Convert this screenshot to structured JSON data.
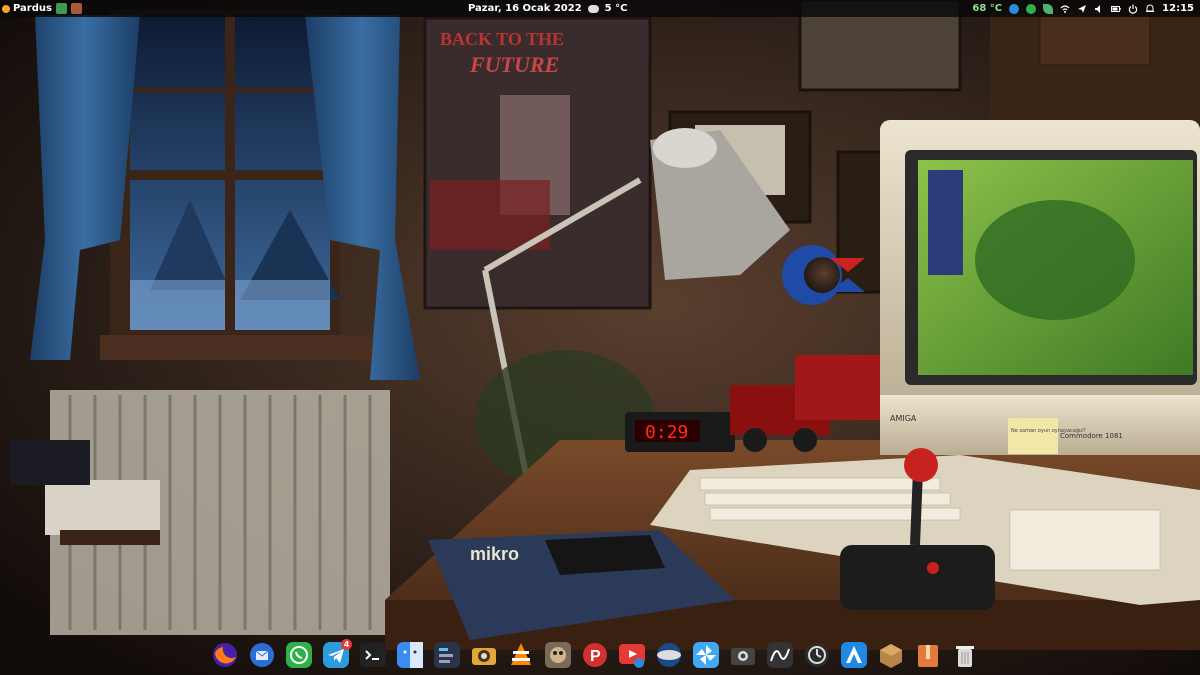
{
  "topbar": {
    "distro_label": "Pardus",
    "date": "Pazar, 16 Ocak 2022",
    "weather_temp": "5 °C",
    "cpu_temp": "68 °C",
    "time": "12:15"
  },
  "wallpaper": {
    "clock_display": "0:29",
    "monitor_brand": "AMIGA",
    "monitor_badge": "Commodore 1081",
    "magazine_title": "mikro",
    "sticky_note": "Ne zaman oyun oynayacağız?"
  },
  "dock": {
    "items": [
      {
        "name": "firefox-icon",
        "badge": ""
      },
      {
        "name": "thunderbird-icon",
        "badge": ""
      },
      {
        "name": "whatsapp-icon",
        "badge": ""
      },
      {
        "name": "telegram-icon",
        "badge": "4"
      },
      {
        "name": "terminal-icon",
        "badge": ""
      },
      {
        "name": "finder-icon",
        "badge": ""
      },
      {
        "name": "settings-panel-icon",
        "badge": ""
      },
      {
        "name": "camera-icon",
        "badge": ""
      },
      {
        "name": "vlc-icon",
        "badge": ""
      },
      {
        "name": "gimp-icon",
        "badge": ""
      },
      {
        "name": "pardus-p-icon",
        "badge": ""
      },
      {
        "name": "downloader-icon",
        "badge": ""
      },
      {
        "name": "vpn-icon",
        "badge": ""
      },
      {
        "name": "pinwheel-icon",
        "badge": ""
      },
      {
        "name": "screenshot-icon",
        "badge": ""
      },
      {
        "name": "curve-icon",
        "badge": ""
      },
      {
        "name": "timeshift-icon",
        "badge": ""
      },
      {
        "name": "app-store-icon",
        "badge": ""
      },
      {
        "name": "package-icon",
        "badge": ""
      },
      {
        "name": "archive-icon",
        "badge": ""
      },
      {
        "name": "trash-icon",
        "badge": ""
      }
    ]
  },
  "colors": {
    "topbar_bg": "#080808",
    "temp_color": "#8be08b",
    "badge_color": "#e53935"
  }
}
